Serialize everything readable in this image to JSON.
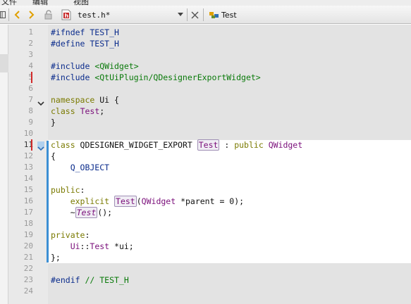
{
  "menu": {
    "items": [
      "文件",
      "编辑",
      "视图"
    ]
  },
  "tab": {
    "filename": "test.h*"
  },
  "class_selector": {
    "label": "Test"
  },
  "editor": {
    "lines": [
      {
        "n": "1",
        "segments": [
          {
            "t": "#ifndef TEST_H",
            "c": "pp"
          }
        ]
      },
      {
        "n": "2",
        "segments": [
          {
            "t": "#define TEST_H",
            "c": "pp"
          }
        ]
      },
      {
        "n": "3",
        "segments": []
      },
      {
        "n": "4",
        "segments": [
          {
            "t": "#include ",
            "c": "pp"
          },
          {
            "t": "<QWidget>",
            "c": "str"
          }
        ]
      },
      {
        "n": "5",
        "segments": [
          {
            "t": "#include ",
            "c": "pp"
          },
          {
            "t": "<QtUiPlugin/QDesignerExportWidget>",
            "c": "str"
          }
        ]
      },
      {
        "n": "6",
        "segments": []
      },
      {
        "n": "7",
        "segments": [
          {
            "t": "namespace",
            "c": "kw"
          },
          {
            "t": " Ui {",
            "c": ""
          }
        ]
      },
      {
        "n": "8",
        "segments": [
          {
            "t": "class",
            "c": "kw"
          },
          {
            "t": " ",
            "c": ""
          },
          {
            "t": "Test",
            "c": "typ"
          },
          {
            "t": ";",
            "c": ""
          }
        ]
      },
      {
        "n": "9",
        "segments": [
          {
            "t": "}",
            "c": ""
          }
        ]
      },
      {
        "n": "10",
        "segments": []
      },
      {
        "n": "11",
        "segments": [
          {
            "t": "class",
            "c": "kw"
          },
          {
            "t": " QDESIGNER_WIDGET_EXPORT ",
            "c": ""
          },
          {
            "t": "Test",
            "c": "typ hl"
          },
          {
            "t": " : ",
            "c": ""
          },
          {
            "t": "public",
            "c": "kw"
          },
          {
            "t": " ",
            "c": ""
          },
          {
            "t": "QWidget",
            "c": "typ"
          }
        ]
      },
      {
        "n": "12",
        "segments": [
          {
            "t": "{",
            "c": ""
          }
        ]
      },
      {
        "n": "13",
        "segments": [
          {
            "t": "    Q_OBJECT",
            "c": "mac"
          }
        ]
      },
      {
        "n": "14",
        "segments": []
      },
      {
        "n": "15",
        "segments": [
          {
            "t": "public",
            "c": "kw"
          },
          {
            "t": ":",
            "c": ""
          }
        ]
      },
      {
        "n": "16",
        "segments": [
          {
            "t": "    ",
            "c": ""
          },
          {
            "t": "explicit",
            "c": "kw"
          },
          {
            "t": " ",
            "c": ""
          },
          {
            "t": "Test",
            "c": "typ hl"
          },
          {
            "t": "(",
            "c": ""
          },
          {
            "t": "QWidget",
            "c": "typ"
          },
          {
            "t": " *parent = 0);",
            "c": ""
          }
        ]
      },
      {
        "n": "17",
        "segments": [
          {
            "t": "    ~",
            "c": ""
          },
          {
            "t": "Test",
            "c": "typ hl ital"
          },
          {
            "t": "();",
            "c": ""
          }
        ]
      },
      {
        "n": "18",
        "segments": []
      },
      {
        "n": "19",
        "segments": [
          {
            "t": "private",
            "c": "kw"
          },
          {
            "t": ":",
            "c": ""
          }
        ]
      },
      {
        "n": "20",
        "segments": [
          {
            "t": "    Ui",
            "c": "typ"
          },
          {
            "t": "::",
            "c": ""
          },
          {
            "t": "Test",
            "c": "typ"
          },
          {
            "t": " *ui;",
            "c": ""
          }
        ]
      },
      {
        "n": "21",
        "segments": [
          {
            "t": "};",
            "c": ""
          }
        ]
      },
      {
        "n": "22",
        "segments": []
      },
      {
        "n": "23",
        "segments": [
          {
            "t": "#endif",
            "c": "pp"
          },
          {
            "t": " // TEST_H",
            "c": "cmt"
          }
        ]
      },
      {
        "n": "24",
        "segments": []
      }
    ],
    "current_line": "11",
    "fold_markers": [
      "7",
      "11"
    ],
    "changed_lines": [
      "5",
      "11"
    ]
  }
}
